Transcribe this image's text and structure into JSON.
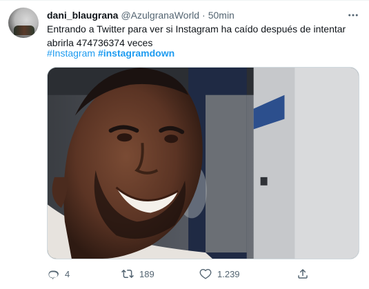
{
  "tweet": {
    "author_name": "dani_blaugrana",
    "handle": "@AzulgranaWorld",
    "separator": "·",
    "time": "50min",
    "text": "Entrando a Twitter para ver si Instagram ha caído después de intentar abrirla 474736374 veces",
    "hashtags": [
      "#Instagram",
      "#instagramdown"
    ]
  },
  "actions": {
    "reply_count": "4",
    "retweet_count": "189",
    "like_count": "1.239"
  },
  "icons": {
    "more": "more-horizontal-icon",
    "reply": "reply-icon",
    "retweet": "retweet-icon",
    "like": "heart-icon",
    "share": "share-icon"
  },
  "colors": {
    "text": "#0f1419",
    "secondary": "#536471",
    "link": "#1d9bf0",
    "border": "#cfd9de"
  }
}
